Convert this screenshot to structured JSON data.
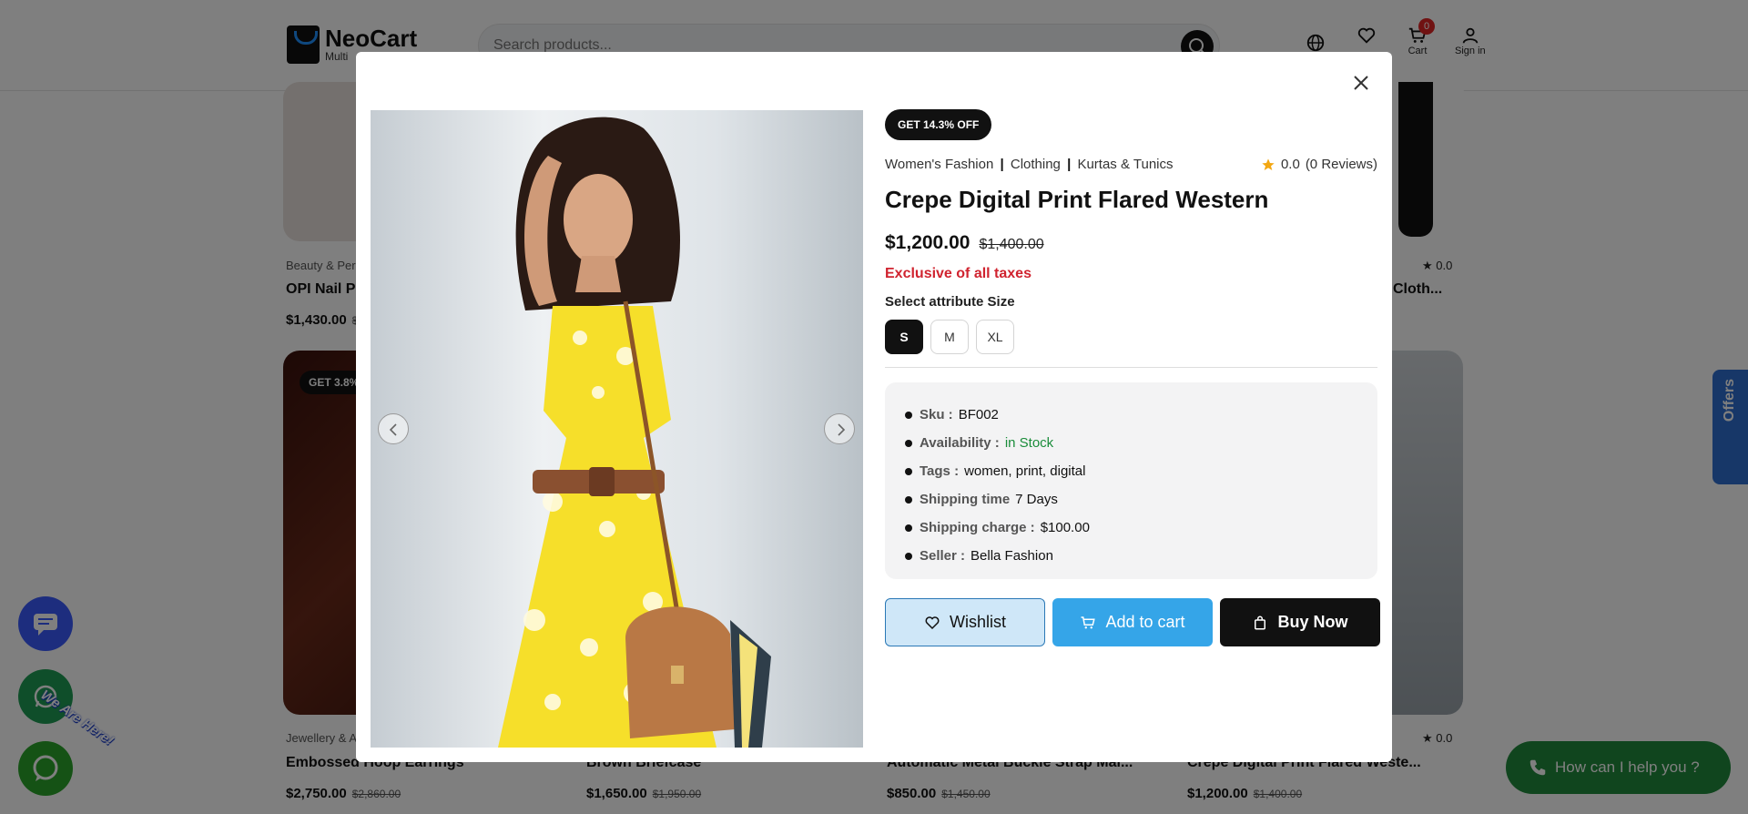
{
  "header": {
    "brand": "NeoCart",
    "brand_sub": "Multi",
    "search_placeholder": "Search products...",
    "cart_count": "0",
    "cart_label": "Cart",
    "signin_label": "Sign in"
  },
  "background_products": [
    {
      "category": "Beauty & Per",
      "name": "OPI Nail P",
      "price": "$1,430.00",
      "old_price": "$"
    },
    {
      "category": "",
      "name": "Cloth...",
      "price": "",
      "old_price": "",
      "rating": "0.0"
    },
    {
      "category": "Jewellery & A",
      "name": "Embossed Hoop Earrings",
      "price": "$2,750.00",
      "old_price": "$2,860.00",
      "badge": "GET 3.8%"
    },
    {
      "category": "",
      "name": "Brown Briefcase",
      "price": "$1,650.00",
      "old_price": "$1,950.00"
    },
    {
      "category": "",
      "name": "Automatic Metal Buckle Strap Mal...",
      "price": "$850.00",
      "old_price": "$1,450.00"
    },
    {
      "category": "",
      "name": "Crepe Digital Print Flared Weste...",
      "price": "$1,200.00",
      "old_price": "$1,400.00",
      "rating": "0.0"
    }
  ],
  "floating": {
    "offers_label": "Offers",
    "we_are_here": "We Are Here!",
    "help_label": "How can I help you ?"
  },
  "modal": {
    "offer_badge": "GET 14.3% OFF",
    "breadcrumb": [
      "Women's Fashion",
      "Clothing",
      "Kurtas & Tunics"
    ],
    "breadcrumb_sep": "|",
    "rating": "0.0",
    "reviews": "(0 Reviews)",
    "title": "Crepe Digital Print Flared Western",
    "price": "$1,200.00",
    "old_price": "$1,400.00",
    "tax_note": "Exclusive of all taxes",
    "attribute_label": "Select attribute Size",
    "sizes": [
      "S",
      "M",
      "XL"
    ],
    "selected_size": "S",
    "specs": [
      {
        "key": "Sku :",
        "value": "BF002"
      },
      {
        "key": "Availability :",
        "value": "in Stock"
      },
      {
        "key": "Tags :",
        "value": "women, print, digital"
      },
      {
        "key": "Shipping time",
        "value": "7 Days"
      },
      {
        "key": "Shipping charge :",
        "value": "$100.00"
      },
      {
        "key": "Seller :",
        "value": "Bella Fashion"
      }
    ],
    "wishlist_label": "Wishlist",
    "add_to_cart_label": "Add to cart",
    "buy_now_label": "Buy Now"
  },
  "colors": {
    "accent_blue": "#35a5e8",
    "tax_red": "#d0232f",
    "stock_green": "#1a8c3a",
    "dress_yellow": "#f6df2a"
  }
}
